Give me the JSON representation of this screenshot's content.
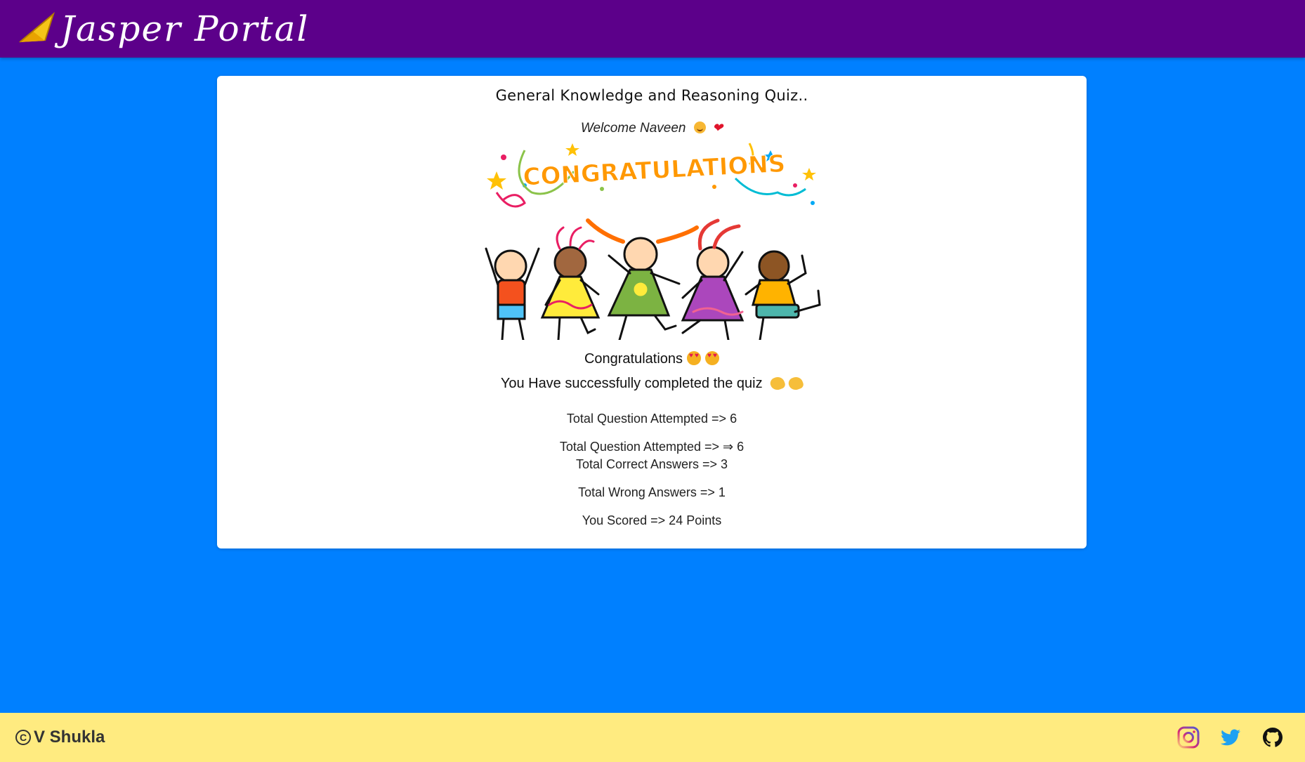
{
  "navbar": {
    "brand_text": "Jasper Portal",
    "brand_icon": "paper-plane-icon"
  },
  "quiz": {
    "title": "General Knowledge and Reasoning Quiz..",
    "welcome": "Welcome Naveen",
    "banner_text": "CONGRATULATIONS",
    "congrats": "Congratulations",
    "success": "You Have successfully completed the quiz",
    "stats": [
      "Total Question Attempted => 6",
      "Total Question Attempted => ⇒ 6",
      "Total Correct Answers => 3",
      "Total Wrong Answers => 1",
      "You Scored => 24 Points"
    ]
  },
  "footer": {
    "copyright_symbol": "C",
    "author": "V Shukla",
    "social": [
      "instagram-icon",
      "twitter-icon",
      "github-icon"
    ]
  },
  "colors": {
    "navbar": "#5c008a",
    "background": "#0080ff",
    "footer": "#ffeb80",
    "card": "#ffffff"
  }
}
